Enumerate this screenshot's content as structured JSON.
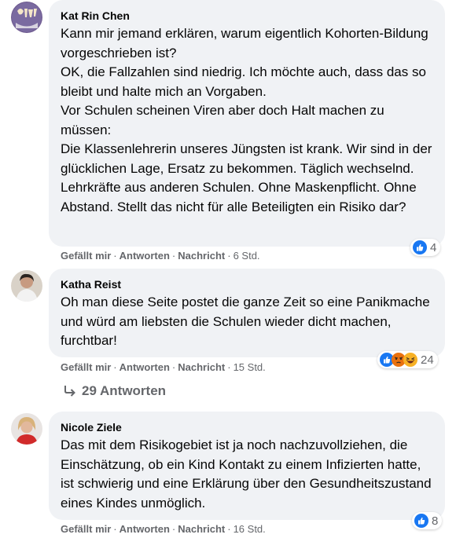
{
  "comments": [
    {
      "author": "Kat Rin Chen",
      "text": "Kann mir jemand erklären, warum eigentlich Kohorten-Bildung vorgeschrieben ist?\nOK, die Fallzahlen sind niedrig. Ich möchte auch, dass das so bleibt und halte mich an Vorgaben.\nVor Schulen scheinen Viren aber doch Halt machen zu müssen:\nDie Klassenlehrerin unseres Jüngsten ist krank. Wir sind in der glücklichen Lage, Ersatz zu bekommen. Täglich wechselnd. Lehrkräfte aus anderen Schulen. Ohne Maskenpflicht. Ohne Abstand. Stellt das nicht für alle Beteiligten ein Risiko dar?",
      "like": "Gefällt mir",
      "reply": "Antworten",
      "message": "Nachricht",
      "time": "6 Std.",
      "reaction_count": "4",
      "reaction_icons": [
        "like-icon"
      ]
    },
    {
      "author": "Katha Reist",
      "text": "Oh man diese Seite postet die ganze Zeit so eine Panikmache und würd am liebsten die Schulen wieder dicht machen, furchtbar!",
      "like": "Gefällt mir",
      "reply": "Antworten",
      "message": "Nachricht",
      "time": "15 Std.",
      "reaction_count": "24",
      "reaction_icons": [
        "like-icon",
        "angry-icon",
        "haha-icon"
      ]
    },
    {
      "author": "Nicole Ziele",
      "text": "Das mit dem Risikogebiet ist ja noch nachzuvollziehen, die Einschätzung, ob ein Kind Kontakt zu einem Infizierten hatte, ist schwierig und eine Erklärung über den Gesundheitszustand eines Kindes unmöglich.",
      "like": "Gefällt mir",
      "reply": "Antworten",
      "message": "Nachricht",
      "time": "16 Std.",
      "reaction_count": "8",
      "reaction_icons": [
        "like-icon"
      ]
    }
  ],
  "replies_link": "29 Antworten",
  "colors": {
    "bubble": "#f0f2f5",
    "muted": "#65676b",
    "like_blue": "#1877f2",
    "angry": "#e9710f",
    "haha": "#f7b125"
  }
}
